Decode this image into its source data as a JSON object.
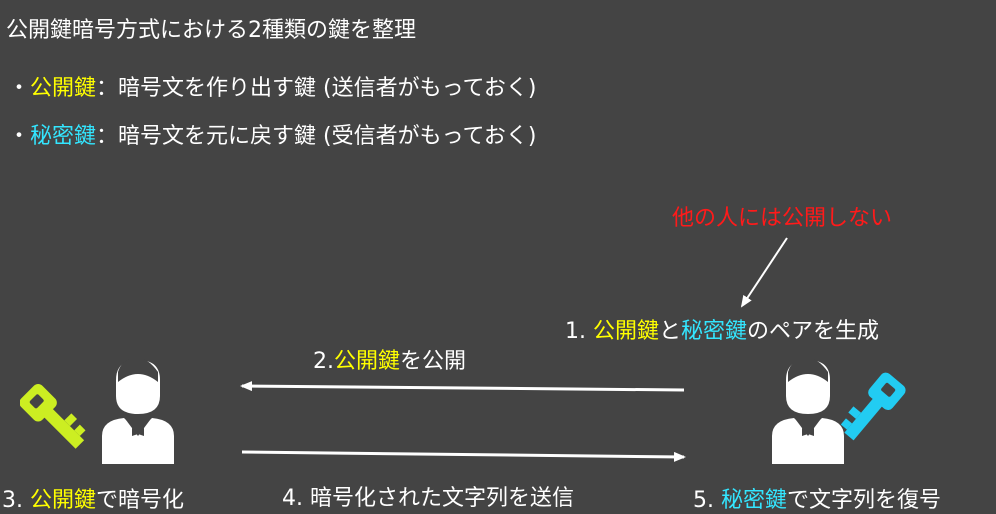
{
  "title": "公開鍵暗号方式における2種類の鍵を整理",
  "bullets": [
    {
      "marker": "・",
      "key": "公開鍵",
      "text": "：暗号文を作り出す鍵 (送信者がもっておく)"
    },
    {
      "marker": "・",
      "key": "秘密鍵",
      "text": "：暗号文を元に戻す鍵 (受信者がもっておく)"
    }
  ],
  "note": "他の人には公開しない",
  "steps": {
    "step1": {
      "prefix": "1. ",
      "key1": "公開鍵",
      "mid": "と",
      "key2": "秘密鍵",
      "suffix": "のペアを生成"
    },
    "step2": {
      "prefix": "2.",
      "key": "公開鍵",
      "suffix": "を公開"
    },
    "step3": {
      "prefix": "3. ",
      "key": "公開鍵",
      "suffix": "で暗号化"
    },
    "step4": {
      "text": "4. 暗号化された文字列を送信"
    },
    "step5": {
      "prefix": "5. ",
      "key": "秘密鍵",
      "suffix": "で文字列を復号"
    }
  },
  "colors": {
    "background": "#444444",
    "public_key": "#ffff00",
    "secret_key": "#33e6ff",
    "note": "#ff1a1a",
    "text": "#ffffff"
  },
  "icons": {
    "sender": "person-icon",
    "sender_key": "key-icon",
    "receiver": "person-icon",
    "receiver_key": "key-icon"
  }
}
